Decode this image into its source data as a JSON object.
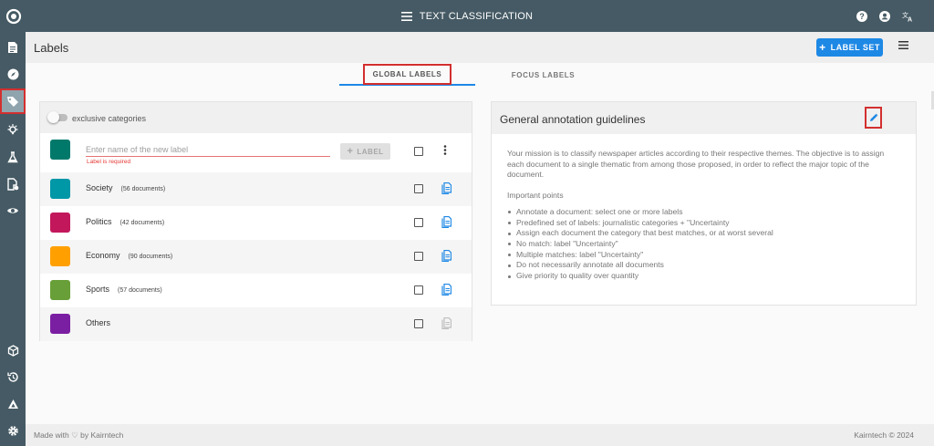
{
  "app": {
    "title": "TEXT CLASSIFICATION"
  },
  "header": {
    "page_title": "Labels",
    "label_set_button": "LABEL SET"
  },
  "tabs": [
    {
      "label": "GLOBAL LABELS",
      "active": true
    },
    {
      "label": "FOCUS LABELS",
      "active": false
    }
  ],
  "labels_card": {
    "toggle_label": "exclusive categories",
    "toggle_on": false,
    "new_label": {
      "color": "#00796b",
      "placeholder": "Enter name of the new label",
      "error": "Label is required",
      "add_button": "LABEL"
    },
    "labels": [
      {
        "name": "Society",
        "count": "(56 documents)",
        "color": "#0097a7"
      },
      {
        "name": "Politics",
        "count": "(42 documents)",
        "color": "#c2185b"
      },
      {
        "name": "Economy",
        "count": "(90 documents)",
        "color": "#ffa000"
      },
      {
        "name": "Sports",
        "count": "(57 documents)",
        "color": "#689f38"
      },
      {
        "name": "Others",
        "count": "",
        "color": "#7b1fa2"
      }
    ]
  },
  "guidelines": {
    "title": "General annotation guidelines",
    "intro": "Your mission is to classify newspaper articles according to their respective themes. The objective is to assign each document to a single thematic from among those proposed, in order to reflect the major topic of the document.",
    "points_title": "Important points",
    "points": [
      "Annotate a document: select one or more labels",
      "Predefined set of labels: journalistic categories + \"Uncertainty",
      "Assign each document the category that best matches, or at worst several",
      "No match: label \"Uncertainty\"",
      "Multiple matches: label \"Uncertainty\"",
      "Do not necessarily annotate all documents",
      "Give priority to quality over quantity"
    ]
  },
  "footer": {
    "left_prefix": "Made with",
    "left_heart": "♡",
    "left_suffix": "by Kairntech",
    "right": "Kairntech © 2024"
  },
  "colors": {
    "topbar": "#455a64",
    "accent": "#1e88e5",
    "error": "#e53935",
    "highlight": "#d32f2f"
  },
  "icons": {
    "sidebar": [
      "documents-icon",
      "explore-icon",
      "labels-icon",
      "suggestion-icon",
      "experiments-icon",
      "document-settings-icon",
      "annotation-view-icon",
      "cube-icon",
      "history-icon",
      "triangle-icon",
      "gear-icon"
    ]
  }
}
